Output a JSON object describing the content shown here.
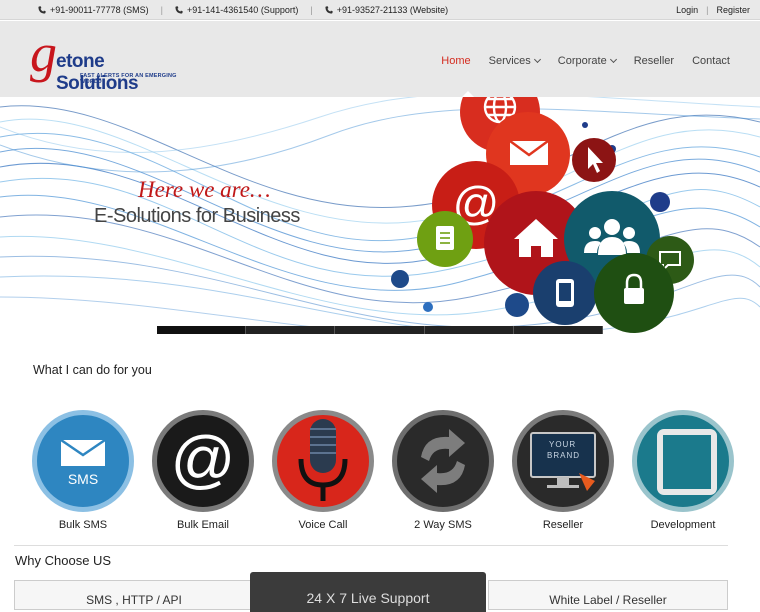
{
  "topbar": {
    "contacts": [
      {
        "icon": "phone-icon",
        "text": "+91-90011-77778 (SMS)"
      },
      {
        "icon": "phone-icon",
        "text": "+91-141-4361540 (Support)"
      },
      {
        "icon": "phone-icon",
        "text": "+91-93527-21133 (Website)"
      }
    ],
    "separator": "|",
    "login": "Login",
    "register": "Register"
  },
  "header": {
    "logo_letter": "g",
    "logo_name": "etone Solutions",
    "logo_tagline": "FAST ALERTS FOR AN EMERGING WORLD"
  },
  "nav": {
    "items": [
      {
        "label": "Home",
        "active": true
      },
      {
        "label": "Services",
        "dropdown": true
      },
      {
        "label": "Corporate",
        "dropdown": true
      },
      {
        "label": "Reseller"
      },
      {
        "label": "Contact"
      }
    ]
  },
  "hero": {
    "line1": "Here we are…",
    "line2": "E-Solutions for Business",
    "slider_count": 5,
    "bubble_icons": [
      "globe-icon",
      "mail-icon",
      "cursor-icon",
      "at-icon",
      "home-icon",
      "team-icon",
      "document-icon",
      "chat-icon",
      "mobile-icon",
      "lock-icon"
    ]
  },
  "services": {
    "title": "What I can do for you",
    "items": [
      {
        "label": "Bulk SMS",
        "icon": "sms-envelope-icon",
        "badge": "SMS",
        "color": "#2e86c1"
      },
      {
        "label": "Bulk Email",
        "icon": "at-icon",
        "color": "#1a1a1a"
      },
      {
        "label": "Voice Call",
        "icon": "microphone-icon",
        "color": "#d8261b"
      },
      {
        "label": "2 Way SMS",
        "icon": "two-way-arrows-icon",
        "color": "#2a2a2a"
      },
      {
        "label": "Reseller",
        "icon": "brand-monitor-icon",
        "badge_line1": "YOUR",
        "badge_line2": "BRAND",
        "color": "#17324d"
      },
      {
        "label": "Development",
        "icon": "tablet-icon",
        "color": "#1b7a8c"
      }
    ]
  },
  "why": {
    "title": "Why Choose US",
    "tabs": [
      "SMS , HTTP / API",
      "24 X 7 Live Support",
      "White Label / Reseller"
    ]
  },
  "colors": {
    "accent": "#d42c20",
    "brand_blue": "#1f3c8a",
    "brand_red": "#c8161d"
  }
}
